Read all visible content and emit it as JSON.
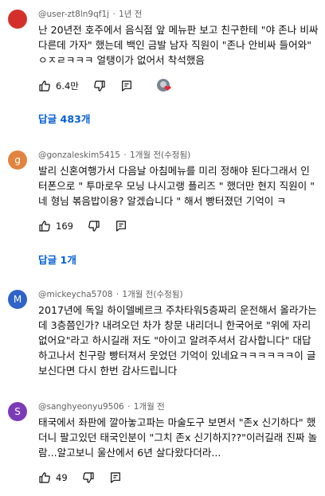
{
  "colors": {
    "accent": "#065fd4",
    "avatar_c1": "#d4302b",
    "avatar_c2": "#e2843f",
    "avatar_c3": "#2f63c8",
    "avatar_c4": "#7b3bb7",
    "heart": "#e8263a"
  },
  "comments": [
    {
      "avatar_letter": "",
      "handle": "@user-zt8ln9qf1j",
      "sep": "·",
      "time": "1년 전",
      "text": "난 20년전 호주에서 음식점 앞 메뉴판 보고 친구한테 \"야 존나 비싸 다른데 가자\" 했는데 백인 금발 남자 직원이 \"존나 안비싸 들어와\" ㅇㅈㄹㅋㅋㅋ 얼탱이가 없어서 착석했음",
      "likes": "6.4만",
      "replies": "답글 483개"
    },
    {
      "avatar_letter": "g",
      "handle": "@gonzaleskim5415",
      "sep": "·",
      "time": "1개월 전(수정됨)",
      "text": "발리 신혼여행가서 다음날 아침메뉴를 미리 정해야 된다그래서 인터폰으로 \" 투마로우 모닝 나시고랭 플리즈 \" 했더만 현지 직원이 \" 네 형님 볶음밥이용? 알겠습니다 \" 해서 빵터졌던 기억이 ㅋ",
      "likes": "169",
      "replies": "답글 1개"
    },
    {
      "avatar_letter": "M",
      "handle": "@mickeycha5708",
      "sep": "·",
      "time": "1개월 전(수정됨)",
      "text": "2017년에 독일 하이델베르크 주차타워5층짜리 운전해서 올라가는데 3층쯤인가? 내려오던 차가 창문 내리더니 한국어로 \"위에 자리 없어요\"라고 하시길래 저도 \"아이고 알려주셔서 감사합니다\" 대답하고나서 친구랑 빵터져서 웃었던 기억이 있네요ㅋㅋㅋㅋㅋㅋ이 글 보신다면 다시 한번 감사드립니다",
      "likes": "",
      "replies": ""
    },
    {
      "avatar_letter": "S",
      "handle": "@sanghyeonyu9506",
      "sep": "·",
      "time": "1개월 전",
      "text": "태국에서 좌판에 깔아놓고파는 마술도구 보면서 \"존x 신기하다\" 했더니 팔고있던 태국인분이 \"그치 존x 신기하지??\"이러길래 진짜 놀람...알고보니 울산에서 6년 살다왔다더라...",
      "likes": "49",
      "replies": ""
    }
  ]
}
